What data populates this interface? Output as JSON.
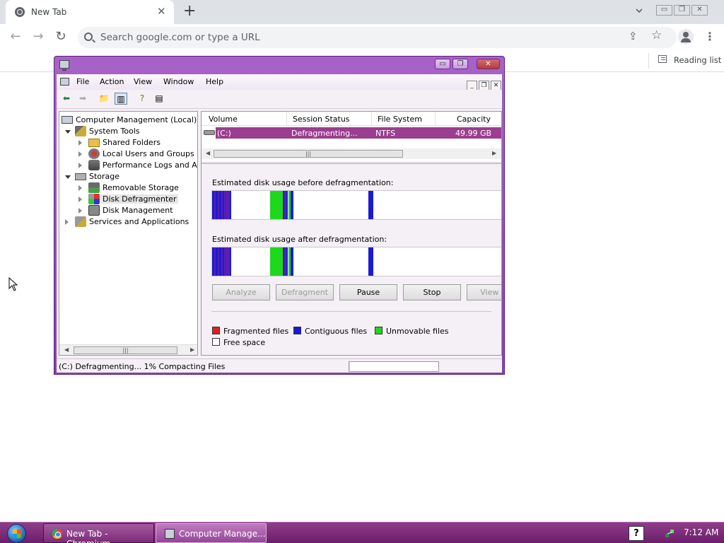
{
  "browser": {
    "tab_title": "New Tab",
    "tab_close": "✕",
    "new_tab": "+",
    "omnibox_placeholder": "Search google.com or type a URL",
    "reading_list": "Reading list",
    "window_buttons": [
      "▭",
      "❐",
      "✕"
    ]
  },
  "mmc": {
    "title_buttons": [
      "▭",
      "❐",
      "✕"
    ],
    "menu": [
      "File",
      "Action",
      "View",
      "Window",
      "Help"
    ],
    "child_buttons": [
      "_",
      "❐",
      "✕"
    ],
    "tree": [
      {
        "label": "Computer Management (Local)",
        "icon": "computer-icon",
        "level": 0
      },
      {
        "label": "System Tools",
        "icon": "tools-icon",
        "level": 1,
        "expanded": true
      },
      {
        "label": "Shared Folders",
        "icon": "folder-icon",
        "level": 2
      },
      {
        "label": "Local Users and Groups",
        "icon": "users-icon",
        "level": 2
      },
      {
        "label": "Performance Logs and Ale",
        "icon": "perf-icon",
        "level": 2
      },
      {
        "label": "Storage",
        "icon": "storage-icon",
        "level": 1,
        "expanded": true
      },
      {
        "label": "Removable Storage",
        "icon": "removable-icon",
        "level": 2
      },
      {
        "label": "Disk Defragmenter",
        "icon": "defrag-icon",
        "level": 2,
        "selected": true
      },
      {
        "label": "Disk Management",
        "icon": "disk-icon",
        "level": 2
      },
      {
        "label": "Services and Applications",
        "icon": "services-icon",
        "level": 1
      }
    ],
    "volume_columns": [
      "Volume",
      "Session Status",
      "File System",
      "Capacity"
    ],
    "volume_row": {
      "volume": "(C:)",
      "status": "Defragmenting...",
      "fs": "NTFS",
      "capacity": "49.99 GB"
    },
    "before_label": "Estimated disk usage before defragmentation:",
    "after_label": "Estimated disk usage after defragmentation:",
    "buttons": [
      {
        "label": "Analyze",
        "enabled": false
      },
      {
        "label": "Defragment",
        "enabled": false
      },
      {
        "label": "Pause",
        "enabled": true
      },
      {
        "label": "Stop",
        "enabled": true
      },
      {
        "label": "View Re",
        "enabled": false
      }
    ],
    "legend": [
      {
        "label": "Fragmented files",
        "color": "#e02020"
      },
      {
        "label": "Contiguous files",
        "color": "#1a1ad6"
      },
      {
        "label": "Unmovable files",
        "color": "#1ed81e"
      },
      {
        "label": "Free space",
        "color": "#ffffff"
      }
    ],
    "status_text": "(C:) Defragmenting... 1%  Compacting Files",
    "status_progress": 0.01
  },
  "colors": {
    "contiguous": "#1a1ad6",
    "fragmented_mix": "#5a1fb0",
    "unmovable": "#1ed81e"
  },
  "taskbar": {
    "items": [
      "New Tab - Chromium",
      "Computer Manage..."
    ],
    "time": "7:12 AM",
    "help": "?"
  }
}
